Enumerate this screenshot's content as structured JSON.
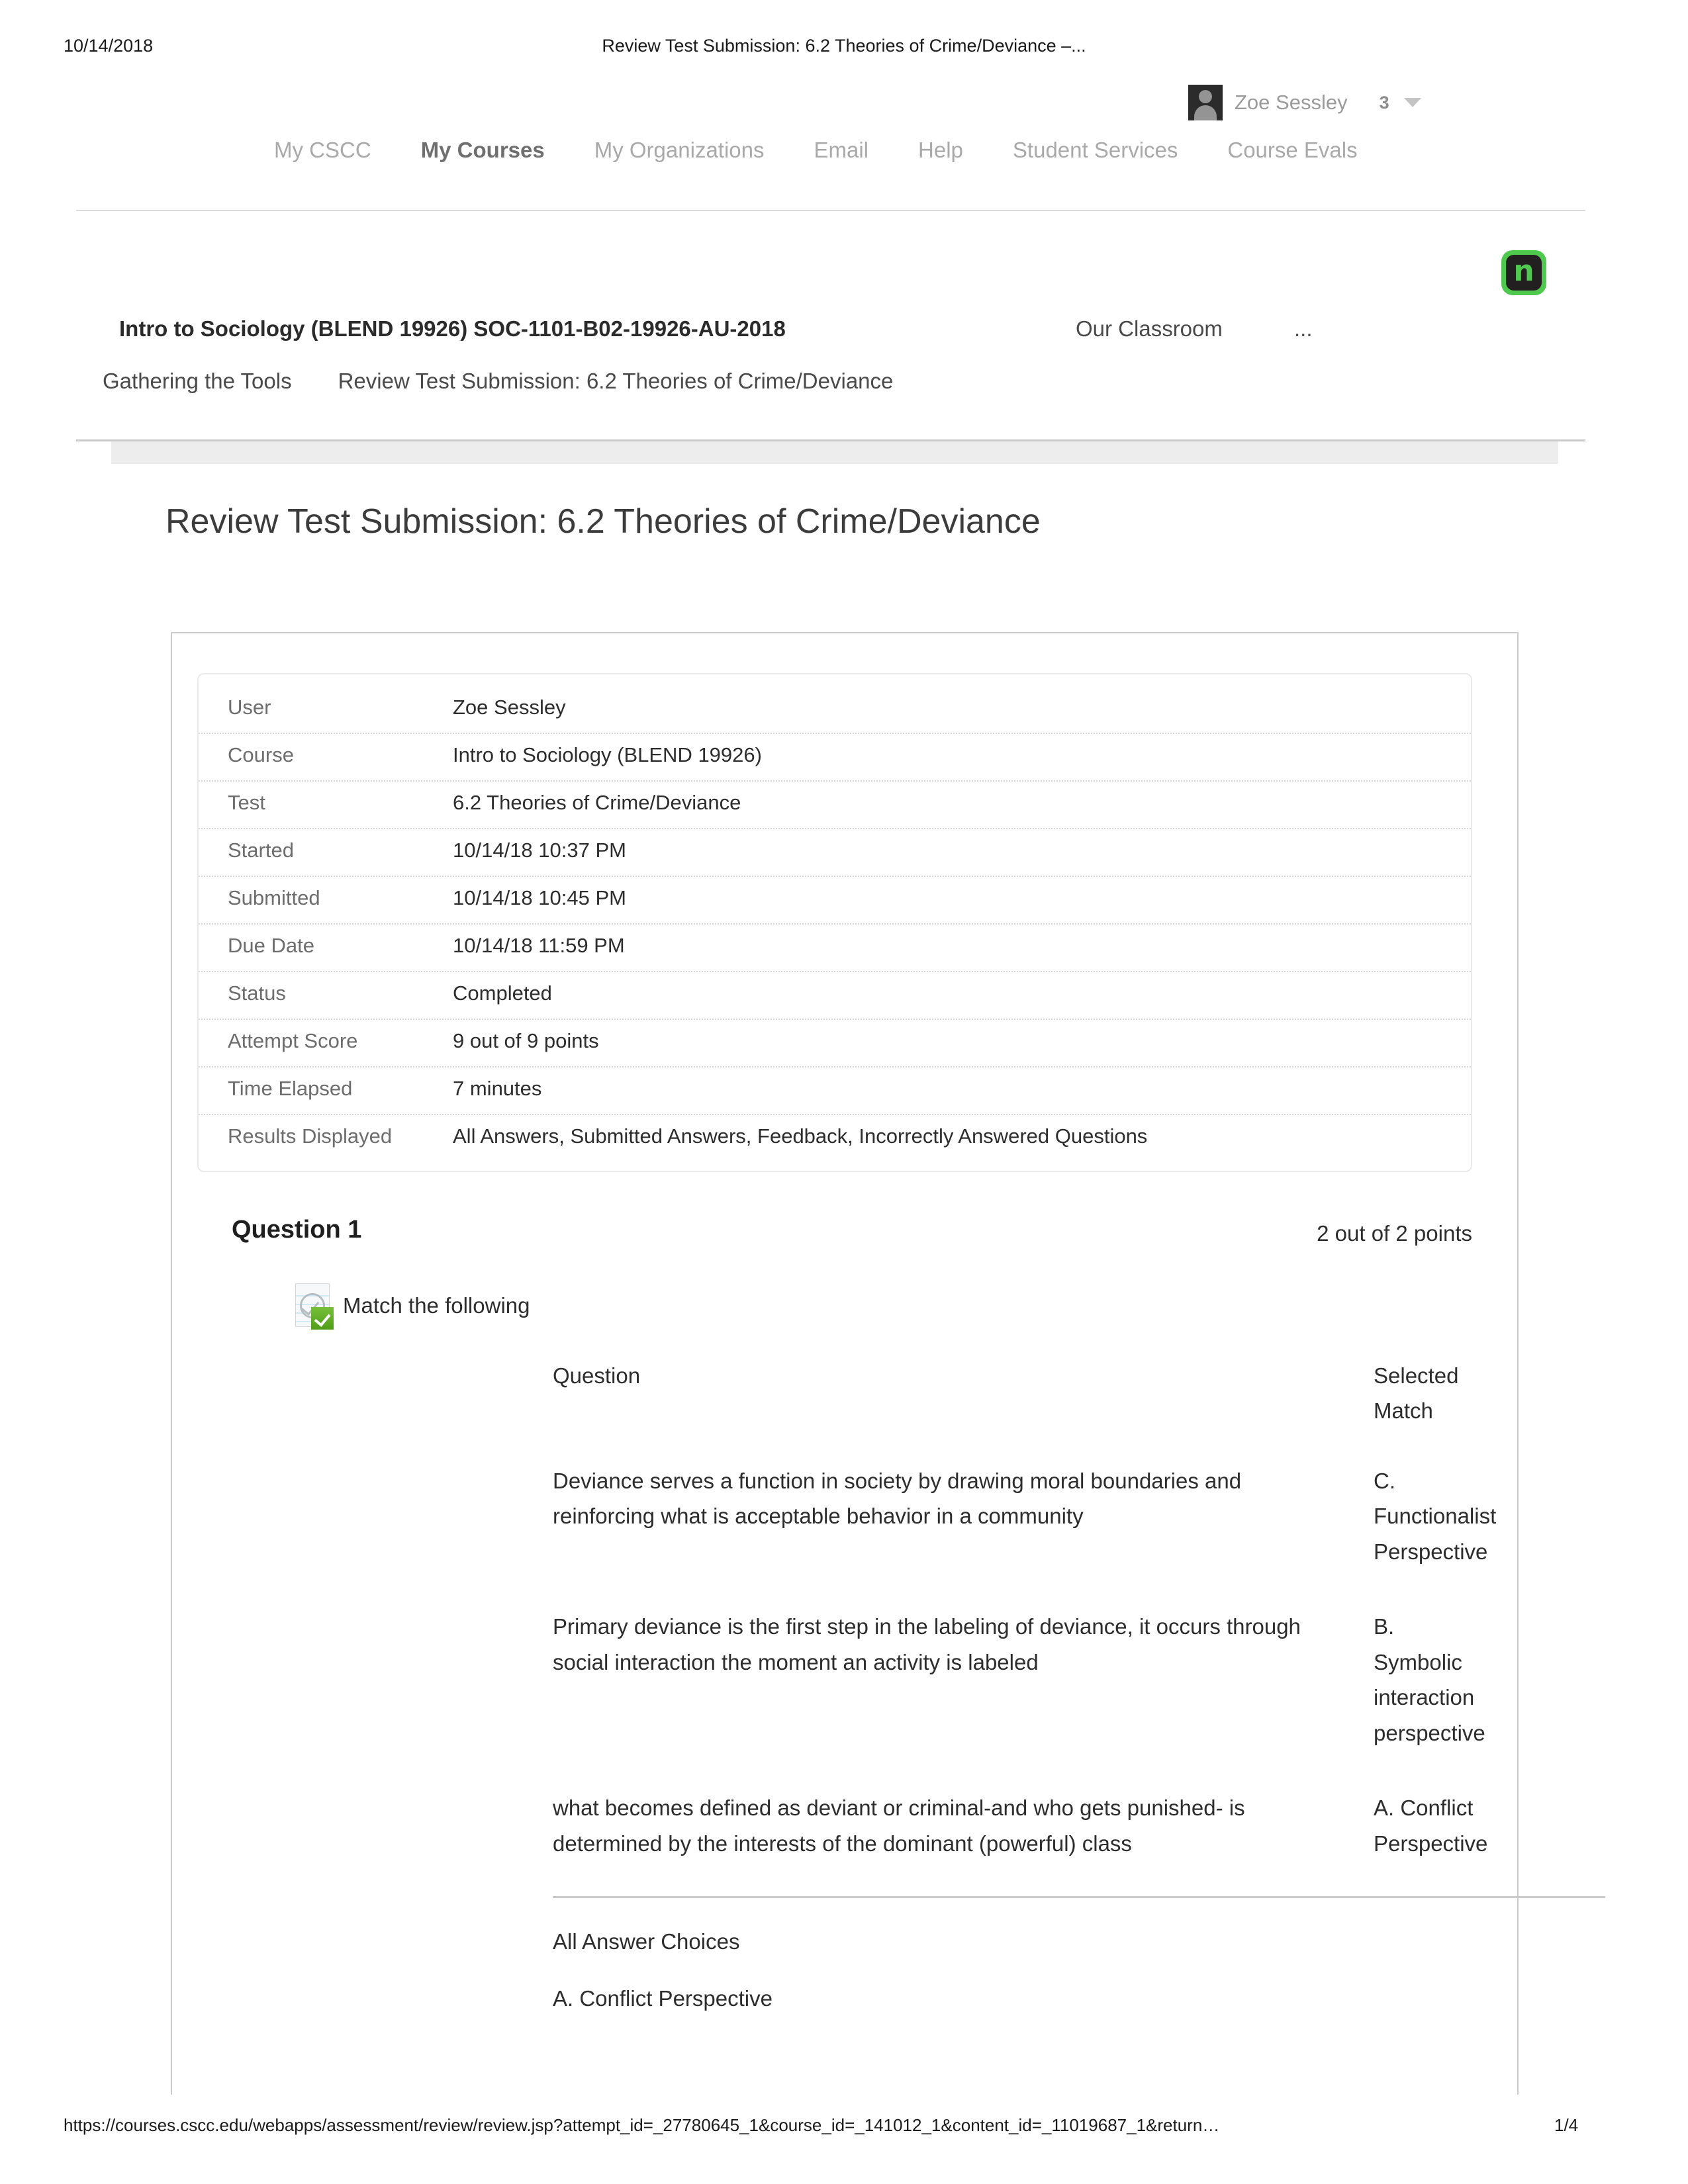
{
  "print": {
    "date": "10/14/2018",
    "header_title": "Review Test Submission: 6.2 Theories of Crime/Deviance –...",
    "footer_url": "https://courses.cscc.edu/webapps/assessment/review/review.jsp?attempt_id=_27780645_1&course_id=_141012_1&content_id=_11019687_1&return…",
    "page_number": "1/4"
  },
  "account": {
    "name": "Zoe Sessley",
    "notification_count": "3",
    "avatar_icon": "user-avatar-icon",
    "caret_icon": "chevron-down-icon"
  },
  "global_nav": {
    "items": [
      {
        "label": "My CSCC",
        "active": false
      },
      {
        "label": "My Courses",
        "active": true
      },
      {
        "label": "My Organizations",
        "active": false
      },
      {
        "label": "Email",
        "active": false
      },
      {
        "label": "Help",
        "active": false
      },
      {
        "label": "Student Services",
        "active": false
      },
      {
        "label": "Course Evals",
        "active": false
      }
    ]
  },
  "brand": {
    "logo_glyph": "n",
    "logo_icon": "nelnet-n-logo-icon",
    "logo_bg": "#4ec94e",
    "logo_inner_bg": "#231f20"
  },
  "course_header": {
    "title": "Intro to Sociology (BLEND 19926) SOC-1101-B02-19926-AU-2018",
    "tab": "Our Classroom",
    "more": "..."
  },
  "breadcrumb": {
    "items": [
      "Gathering the Tools",
      "Review Test Submission: 6.2 Theories of Crime/Deviance"
    ]
  },
  "page": {
    "heading": "Review Test Submission: 6.2 Theories of Crime/Deviance"
  },
  "attempt_info": {
    "rows": [
      {
        "label": "User",
        "value": "Zoe Sessley"
      },
      {
        "label": "Course",
        "value": "Intro to Sociology (BLEND 19926)"
      },
      {
        "label": "Test",
        "value": "6.2 Theories of Crime/Deviance"
      },
      {
        "label": "Started",
        "value": "10/14/18 10:37 PM"
      },
      {
        "label": "Submitted",
        "value": "10/14/18 10:45 PM"
      },
      {
        "label": "Due Date",
        "value": "10/14/18 11:59 PM"
      },
      {
        "label": "Status",
        "value": "Completed"
      },
      {
        "label": "Attempt Score",
        "value": "9 out of 9 points"
      },
      {
        "label": "Time Elapsed",
        "value": "7 minutes"
      },
      {
        "label": "Results Displayed",
        "value": "All Answers, Submitted Answers, Feedback, Incorrectly Answered Questions"
      }
    ]
  },
  "question": {
    "title": "Question 1",
    "points": "2 out of 2 points",
    "prompt": "Match the following",
    "status_icon": "correct-answer-icon",
    "match_headers": {
      "question": "Question",
      "selected_match": "Selected Match"
    },
    "matches": [
      {
        "question": "Deviance serves a function in society by drawing moral boundaries and reinforcing what is acceptable behavior in a community",
        "selected_match": "C. Functionalist Perspective"
      },
      {
        "question": "Primary deviance is the first step in the labeling of deviance, it occurs through social interaction the moment an activity is labeled",
        "selected_match": "B. Symbolic interaction perspective"
      },
      {
        "question": "what becomes defined as deviant or criminal-and who gets punished- is determined by the interests of the dominant (powerful) class",
        "selected_match": "A. Conflict Perspective"
      }
    ],
    "all_choices_label": "All Answer Choices",
    "all_choices": [
      "A. Conflict Perspective"
    ]
  }
}
